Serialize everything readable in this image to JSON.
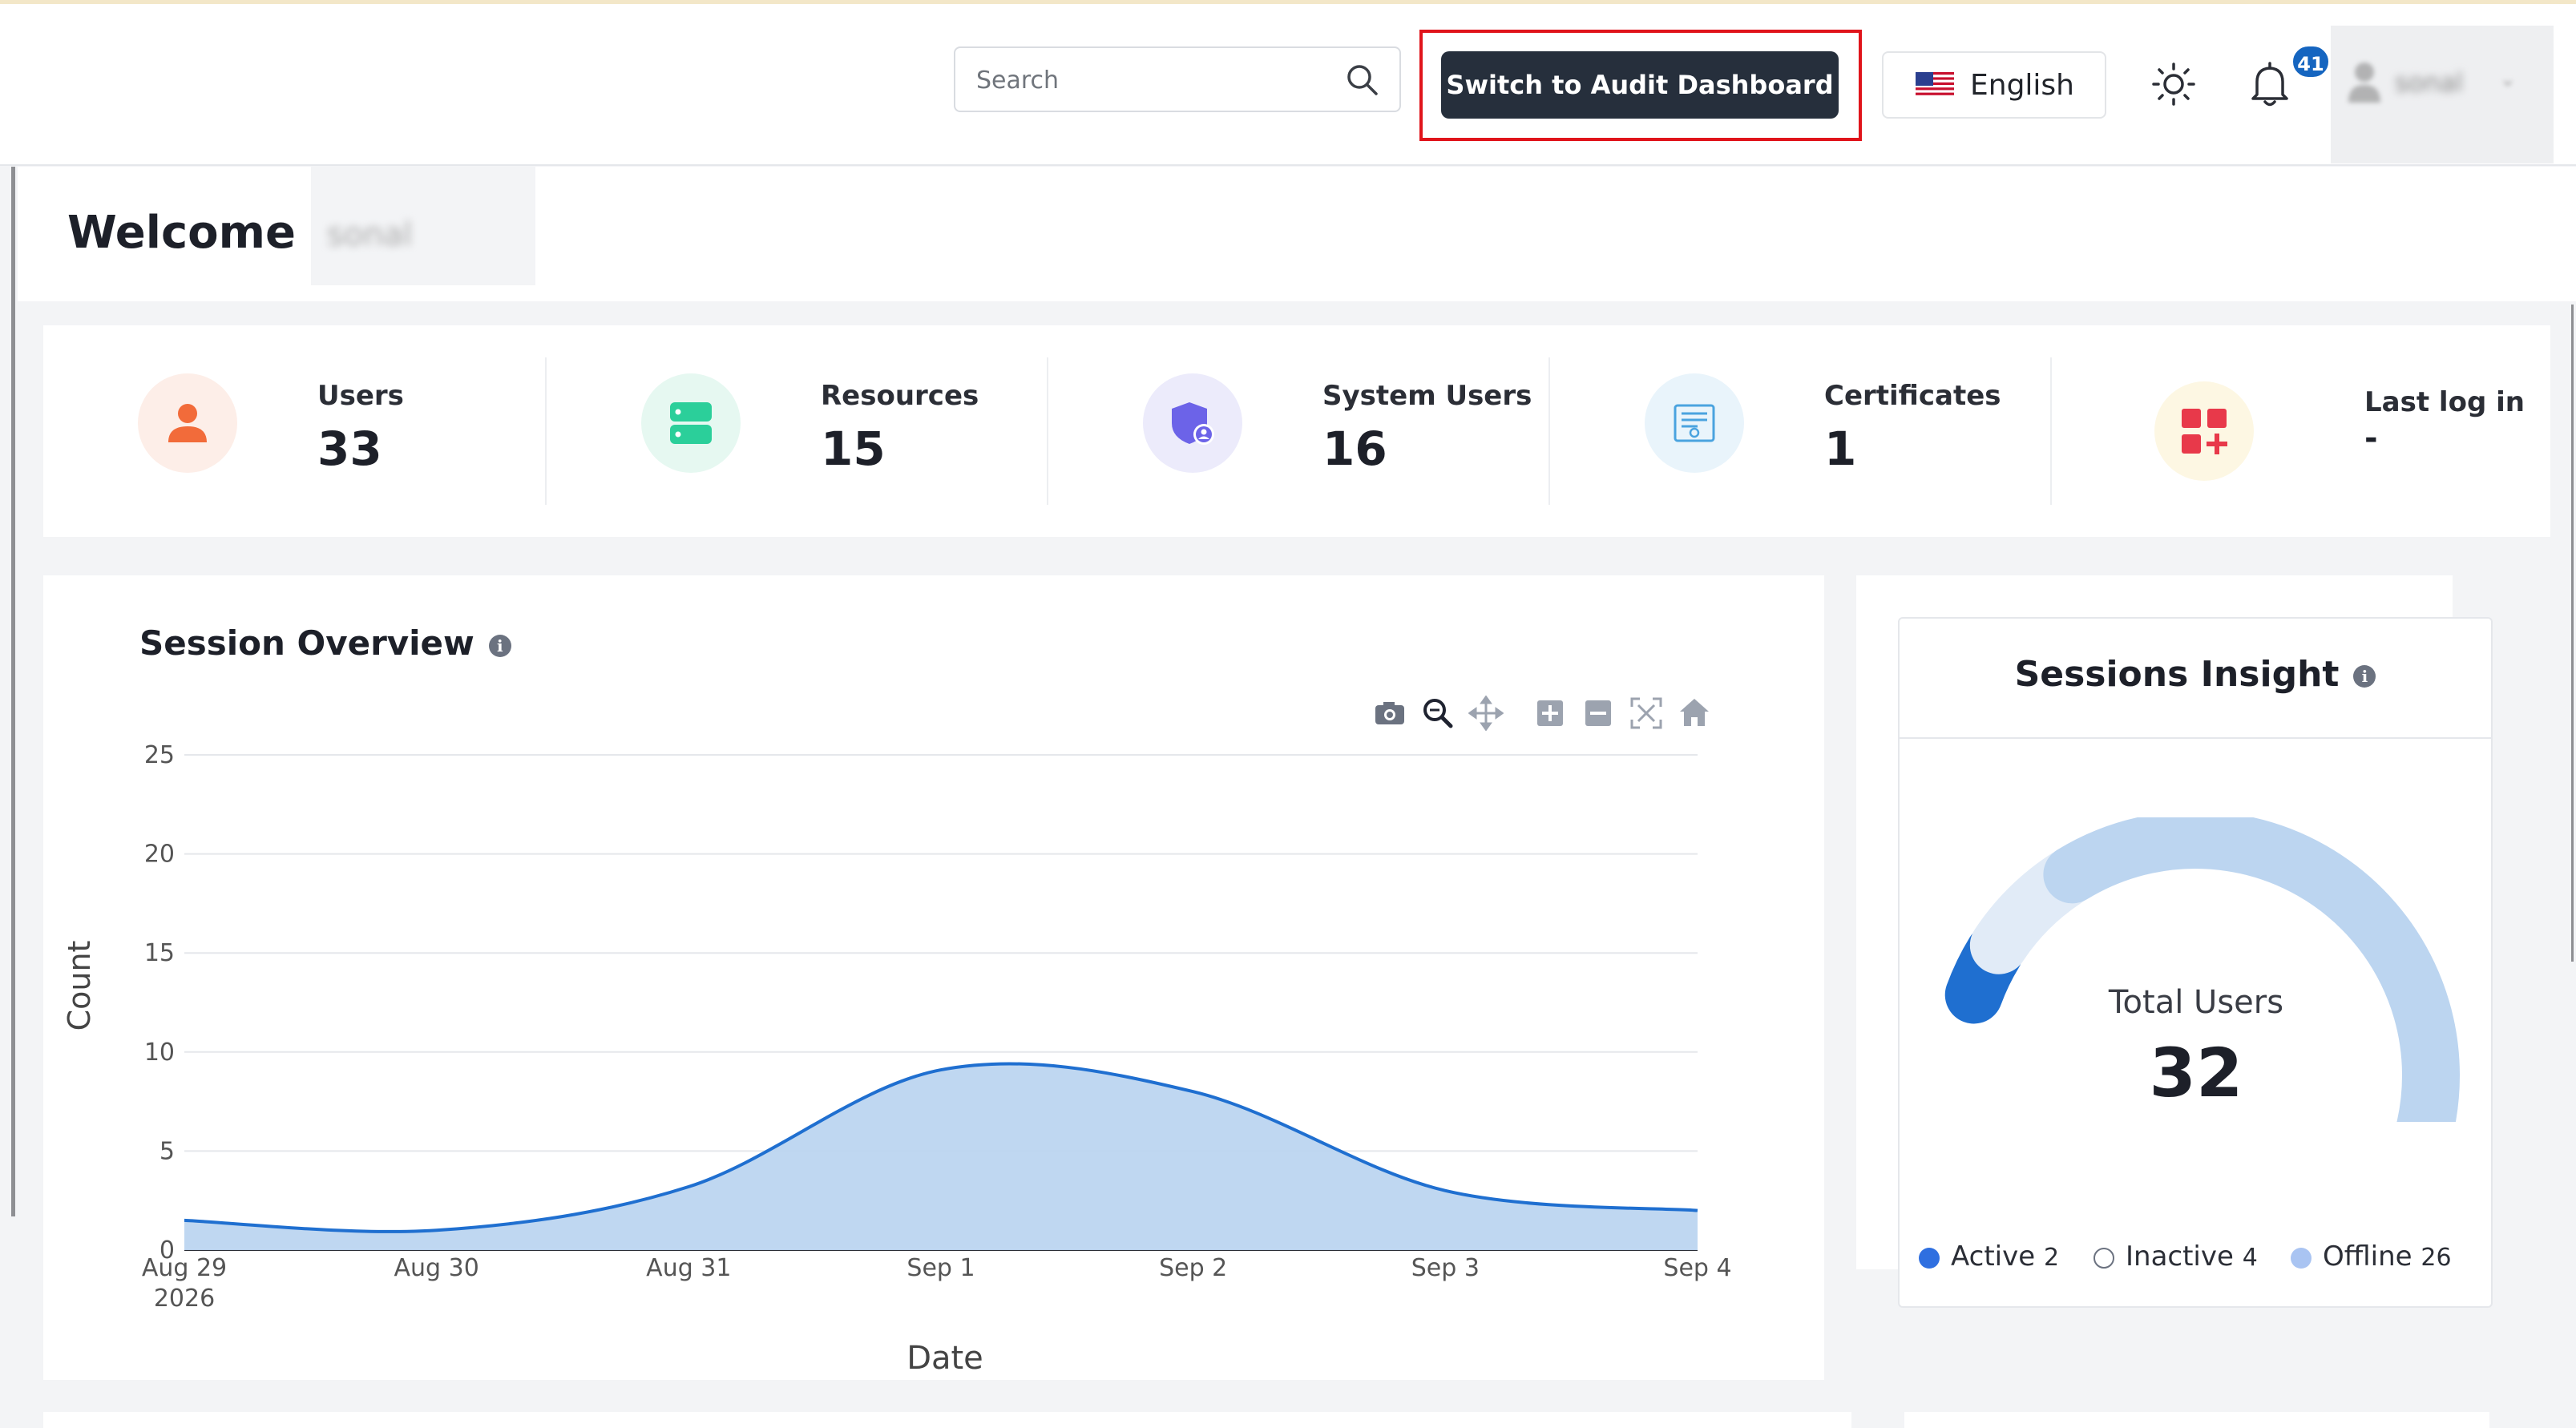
{
  "header": {
    "search_placeholder": "Search",
    "switch_button": "Switch to Audit Dashboard",
    "language": "English",
    "notification_count": "41",
    "profile_name": "sonal"
  },
  "welcome": {
    "greeting": "Welcome ,",
    "name": "sonal"
  },
  "stats": [
    {
      "label": "Users",
      "value": "33",
      "icon": "user-icon",
      "bg": "#fdeee8",
      "color": "#f26b3a"
    },
    {
      "label": "Resources",
      "value": "15",
      "icon": "server-icon",
      "bg": "#e6f8f1",
      "color": "#2bcf9a"
    },
    {
      "label": "System Users",
      "value": "16",
      "icon": "shield-user-icon",
      "bg": "#ecebfb",
      "color": "#6c63e8"
    },
    {
      "label": "Certificates",
      "value": "1",
      "icon": "certificate-icon",
      "bg": "#e9f4fb",
      "color": "#4aa3df"
    },
    {
      "label": "Last log in",
      "value": "-",
      "icon": "apps-add-icon",
      "bg": "#fdf7e3",
      "color": "#e8394a"
    }
  ],
  "session_overview": {
    "title": "Session Overview"
  },
  "chart_data": {
    "type": "area",
    "x": [
      "Aug 29",
      "Aug 30",
      "Aug 31",
      "Sep 1",
      "Sep 2",
      "Sep 3",
      "Sep 4"
    ],
    "x_year_label": "2026",
    "series": [
      {
        "values": [
          1.5,
          1.0,
          3.2,
          9.1,
          8.0,
          3.0,
          2.0
        ]
      }
    ],
    "xlabel": "Date",
    "ylabel": "Count",
    "ylim": [
      0,
      25
    ],
    "yticks": [
      0,
      5,
      10,
      15,
      20,
      25
    ],
    "grid": true,
    "fill_color": "#bcd5f0",
    "line_color": "#1f6fd0"
  },
  "sessions_insight": {
    "title": "Sessions Insight",
    "center_label": "Total Users",
    "total": "32",
    "segments": [
      {
        "name": "Active",
        "value": 2,
        "color": "#1f6fd0"
      },
      {
        "name": "Inactive",
        "value": 4,
        "color": "#e1ebf7"
      },
      {
        "name": "Offline",
        "value": 26,
        "color": "#bcd5f0"
      }
    ],
    "legend": [
      {
        "label": "Active",
        "count": "2",
        "color": "#1f6fd0"
      },
      {
        "label": "Inactive",
        "count": "4",
        "color": "#ffffff"
      },
      {
        "label": "Offline",
        "count": "26",
        "color": "#a9c4f2"
      }
    ]
  }
}
